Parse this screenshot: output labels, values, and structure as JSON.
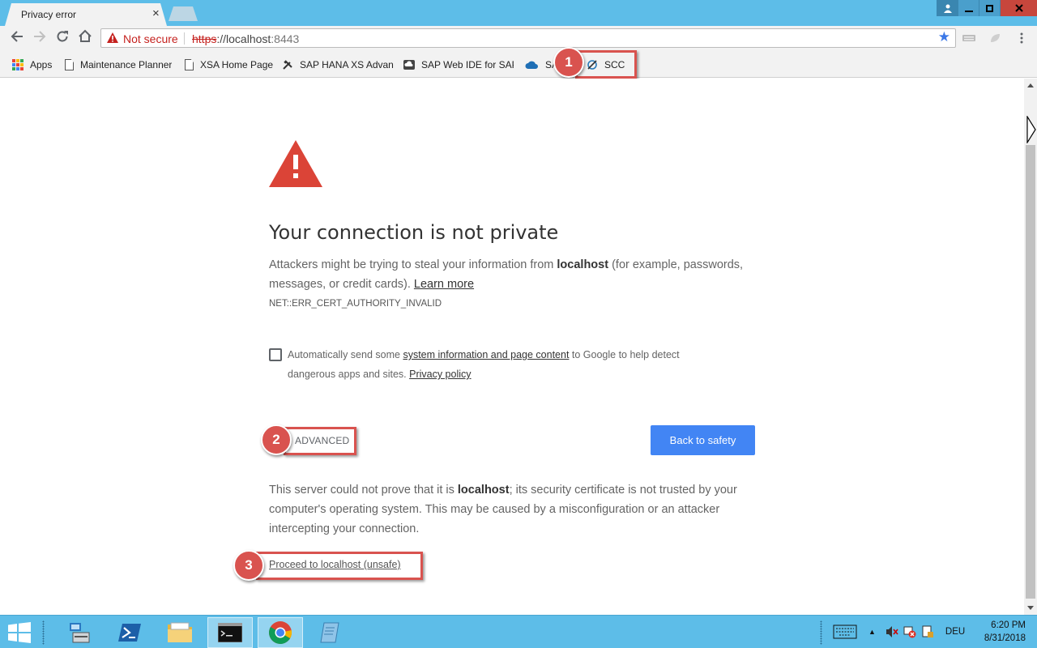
{
  "browser": {
    "tab_title": "Privacy error",
    "tab_close": "×",
    "security_label": "Not secure",
    "url_scheme": "https",
    "url_rest": "://localhost",
    "url_port": ":8443"
  },
  "bookmarks": [
    {
      "label": "Apps",
      "icon": "apps-grid-icon"
    },
    {
      "label": "Maintenance Planner",
      "icon": "page-icon"
    },
    {
      "label": "XSA Home Page",
      "icon": "page-icon"
    },
    {
      "label": "SAP HANA XS Advanc",
      "icon": "tools-icon"
    },
    {
      "label": "SAP Web IDE for SAP",
      "icon": "cloud-ide-icon"
    },
    {
      "label": "SA",
      "icon": "cloud-icon"
    },
    {
      "label": "SCC",
      "icon": "scc-icon"
    }
  ],
  "page": {
    "heading": "Your connection is not private",
    "intro_before": "Attackers might be trying to steal your information from ",
    "intro_host": "localhost",
    "intro_after": " (for example, passwords, messages, or credit cards). ",
    "learn_more": "Learn more",
    "error_code": "NET::ERR_CERT_AUTHORITY_INVALID",
    "report_before": "Automatically send some ",
    "report_link": "system information and page content",
    "report_after": " to Google to help detect dangerous apps and sites. ",
    "privacy_policy": "Privacy policy",
    "advanced_label": "ADVANCED",
    "back_label": "Back to safety",
    "details_before": "This server could not prove that it is ",
    "details_host": "localhost",
    "details_after": "; its security certificate is not trusted by your computer's operating system. This may be caused by a misconfiguration or an attacker intercepting your connection.",
    "proceed_label": "Proceed to localhost (unsafe)"
  },
  "annotations": [
    {
      "number": "1",
      "target": "SCC bookmark"
    },
    {
      "number": "2",
      "target": "ADVANCED"
    },
    {
      "number": "3",
      "target": "Proceed to localhost (unsafe)"
    }
  ],
  "taskbar": {
    "apps": [
      "server-manager-icon",
      "powershell-icon",
      "file-explorer-icon",
      "command-prompt-icon",
      "chrome-icon",
      "notepad-icon"
    ],
    "language": "DEU",
    "time": "6:20 PM",
    "date": "8/31/2018"
  },
  "colors": {
    "chrome_frame": "#5dbde8",
    "warning_red": "#db4437",
    "primary_button": "#4285f4",
    "annotation_red": "#d9534f"
  }
}
